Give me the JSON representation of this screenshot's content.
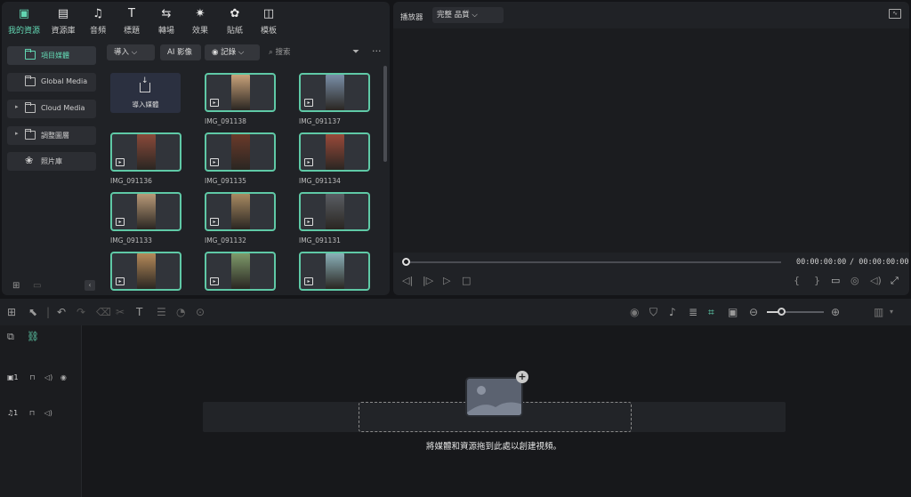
{
  "library": {
    "tabs": [
      {
        "label": "我的資源",
        "icon": "my-media-icon",
        "glyph": "▣"
      },
      {
        "label": "資源庫",
        "icon": "stock-media-icon",
        "glyph": "▤"
      },
      {
        "label": "音頻",
        "icon": "audio-icon",
        "glyph": "♫"
      },
      {
        "label": "標題",
        "icon": "titles-icon",
        "glyph": "T"
      },
      {
        "label": "轉場",
        "icon": "transitions-icon",
        "glyph": "⇆"
      },
      {
        "label": "效果",
        "icon": "effects-icon",
        "glyph": "✷"
      },
      {
        "label": "貼紙",
        "icon": "stickers-icon",
        "glyph": "✿"
      },
      {
        "label": "模板",
        "icon": "templates-icon",
        "glyph": "◫"
      }
    ],
    "sidebar": {
      "items": [
        {
          "label": "項目媒體"
        },
        {
          "label": "Global Media"
        },
        {
          "label": "Cloud Media"
        },
        {
          "label": "調整圖層"
        },
        {
          "label": "照片庫"
        }
      ]
    },
    "toolbar": {
      "import_label": "導入 ⌵",
      "ai_image_label": "AI 影像",
      "record_label": "◉  記錄  ⌵",
      "search_placeholder": "搜索"
    },
    "import_card_label": "導入媒體",
    "media": [
      {
        "name": "IMG_091138",
        "color": "#c9a27a"
      },
      {
        "name": "IMG_091137",
        "color": "#7a8fa8"
      },
      {
        "name": "IMG_091136",
        "color": "#8a4a3a"
      },
      {
        "name": "IMG_091135",
        "color": "#6a3a2a"
      },
      {
        "name": "IMG_091134",
        "color": "#9a4a3a"
      },
      {
        "name": "IMG_091133",
        "color": "#b99a78"
      },
      {
        "name": "IMG_091132",
        "color": "#a88a62"
      },
      {
        "name": "IMG_091131",
        "color": "#5a5e64"
      },
      {
        "name": "",
        "color": "#b58a5a"
      },
      {
        "name": "",
        "color": "#7e9a6a"
      },
      {
        "name": "",
        "color": "#8ab0b8"
      }
    ]
  },
  "player": {
    "title": "播放器",
    "quality": "完整 品質 ⌵",
    "current_time": "00:00:00:00",
    "total_time": "/ 00:00:00:00"
  },
  "timeline": {
    "video_track_label": "▣1",
    "audio_track_label": "♫1",
    "drop_hint": "將媒體和資源拖到此處以創建視頻。"
  },
  "colors": {
    "accent": "#62d6b2",
    "thumb_border": "#5fc9a6"
  }
}
